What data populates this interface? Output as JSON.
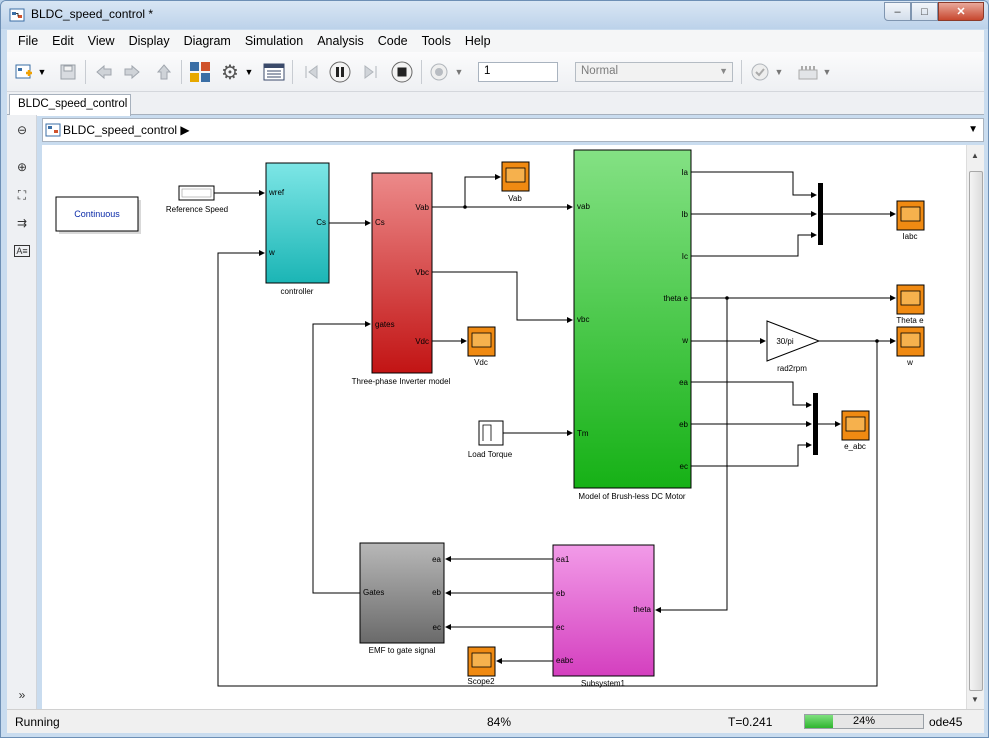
{
  "window": {
    "title": "BLDC_speed_control *",
    "minimize": "‒",
    "maximize": "□",
    "close": "✕"
  },
  "menu": [
    "File",
    "Edit",
    "View",
    "Display",
    "Diagram",
    "Simulation",
    "Analysis",
    "Code",
    "Tools",
    "Help"
  ],
  "toolbar": {
    "stop_time": "1",
    "sim_mode": "Normal"
  },
  "tab": {
    "label": "BLDC_speed_control"
  },
  "address": {
    "path": "BLDC_speed_control",
    "arrow": "▶"
  },
  "blocks": {
    "continuous": "Continuous",
    "reference_speed": "Reference Speed",
    "controller": {
      "label": "controller",
      "in1": "wref",
      "in2": "w",
      "out": "Cs"
    },
    "inverter": {
      "label": "Three-phase Inverter model",
      "in1": "Cs",
      "in2": "gates",
      "out1": "Vab",
      "out2": "Vbc",
      "out3": "Vdc"
    },
    "vab_scope": "Vab",
    "vdc_scope": "Vdc",
    "motor": {
      "label": "Model of Brush-less DC Motor",
      "in1": "vab",
      "in2": "vbc",
      "in3": "Tm",
      "outs": [
        "Ia",
        "Ib",
        "Ic",
        "theta e",
        "w",
        "ea",
        "eb",
        "ec"
      ]
    },
    "load_torque": "Load Torque",
    "iabc_scope": "Iabc",
    "theta_scope": "Theta e",
    "gain": {
      "label": "rad2rpm",
      "value": "30/pi"
    },
    "w_scope": "w",
    "eabc_scope": "e_abc",
    "emf_gate": {
      "label": "EMF to gate signal",
      "in1": "ea",
      "in2": "eb",
      "in3": "ec",
      "out": "Gates"
    },
    "subsystem": {
      "label": "Subsystem1",
      "out1": "ea1",
      "out2": "eb",
      "out3": "ec",
      "out4": "eabc",
      "in": "theta"
    },
    "scope2": "Scope2"
  },
  "status": {
    "state": "Running",
    "zoom": "84%",
    "time": "T=0.241",
    "progress_text": "24%",
    "progress": 0.24,
    "solver": "ode45"
  },
  "colors": {
    "controller": "#33c7c7",
    "inverter": "#d83a3a",
    "motor": "#3ec33e",
    "emf_gate": "#8a8a8a",
    "subsystem": "#e35fd0",
    "scope": "#f08a12"
  }
}
